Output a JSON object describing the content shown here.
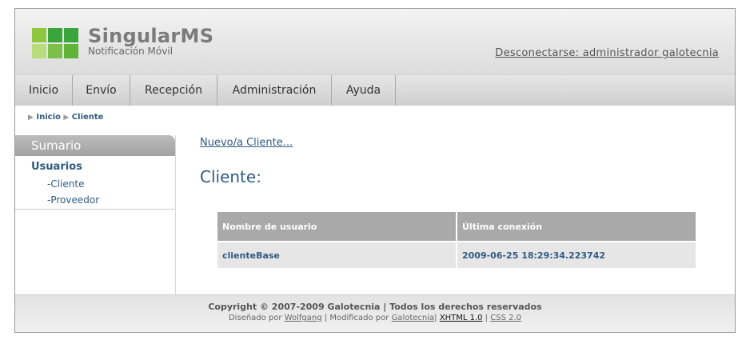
{
  "brand": {
    "title": "SingularMS",
    "subtitle": "Notificación Móvil",
    "logo_colors": [
      "#8dc63f",
      "#3aa53a",
      "#b7dd7d",
      "#7cc04a",
      "#5fb336",
      "#9ccf60"
    ]
  },
  "header": {
    "logout_label": "Desconectarse: administrador galotecnia"
  },
  "nav": {
    "items": [
      {
        "label": "Inicio"
      },
      {
        "label": "Envío"
      },
      {
        "label": "Recepción"
      },
      {
        "label": "Administración"
      },
      {
        "label": "Ayuda"
      }
    ]
  },
  "breadcrumb": {
    "items": [
      "Inicio",
      "Cliente"
    ]
  },
  "sidebar": {
    "title": "Sumario",
    "group": "Usuarios",
    "links": [
      "-Cliente",
      "-Proveedor"
    ]
  },
  "main": {
    "new_link": "Nuevo/a Cliente...",
    "title": "Cliente:",
    "table": {
      "headers": [
        "Nombre de usuario",
        "Última conexión"
      ],
      "rows": [
        [
          "clienteBase",
          "2009-06-25 18:29:34.223742"
        ]
      ]
    }
  },
  "footer": {
    "line1": "Copyright © 2007-2009 Galotecnia | Todos los derechos reservados",
    "designed_by_prefix": "Diseñado por",
    "designer": "Wolfgang",
    "separator1": "|",
    "modified_by_prefix": "Modificado por",
    "modifier": "Galotecnia",
    "separator2": "|",
    "xhtml": "XHTML 1.0",
    "separator3": "|",
    "css": "CSS 2.0"
  },
  "colors": {
    "link_blue": "#2f5b82",
    "sidebar_title_bg": "#a9a9a9",
    "table_header_bg": "#a9a9a9",
    "table_row_bg": "#e6e6e6"
  }
}
